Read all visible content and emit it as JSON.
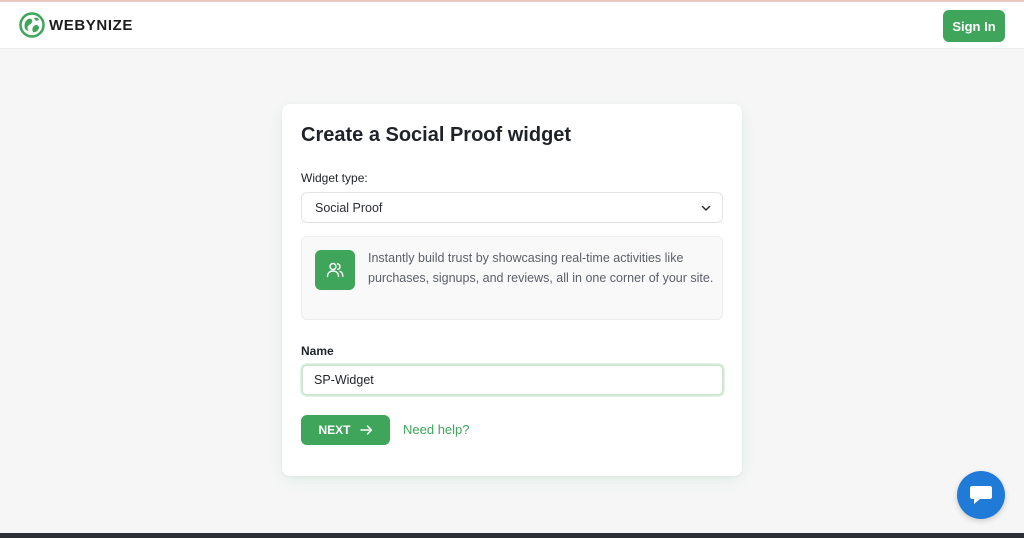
{
  "header": {
    "logo_text": "WEBYNIZE",
    "signin_label": "Sign In"
  },
  "card": {
    "title": "Create a Social Proof widget",
    "widget_type_label": "Widget type:",
    "widget_type_value": "Social Proof",
    "info_text": "Instantly build trust by showcasing real-time activities like purchases, signups, and reviews, all in one corner of your site.",
    "info_icon": "users-icon",
    "name_label": "Name",
    "name_value": "SP-Widget",
    "next_label": "NEXT",
    "help_label": "Need help?"
  },
  "chat": {
    "icon": "chat-bubble-icon"
  },
  "colors": {
    "accent": "#3ea55a",
    "chat": "#1f7ad8",
    "background": "#f6f6f7"
  }
}
